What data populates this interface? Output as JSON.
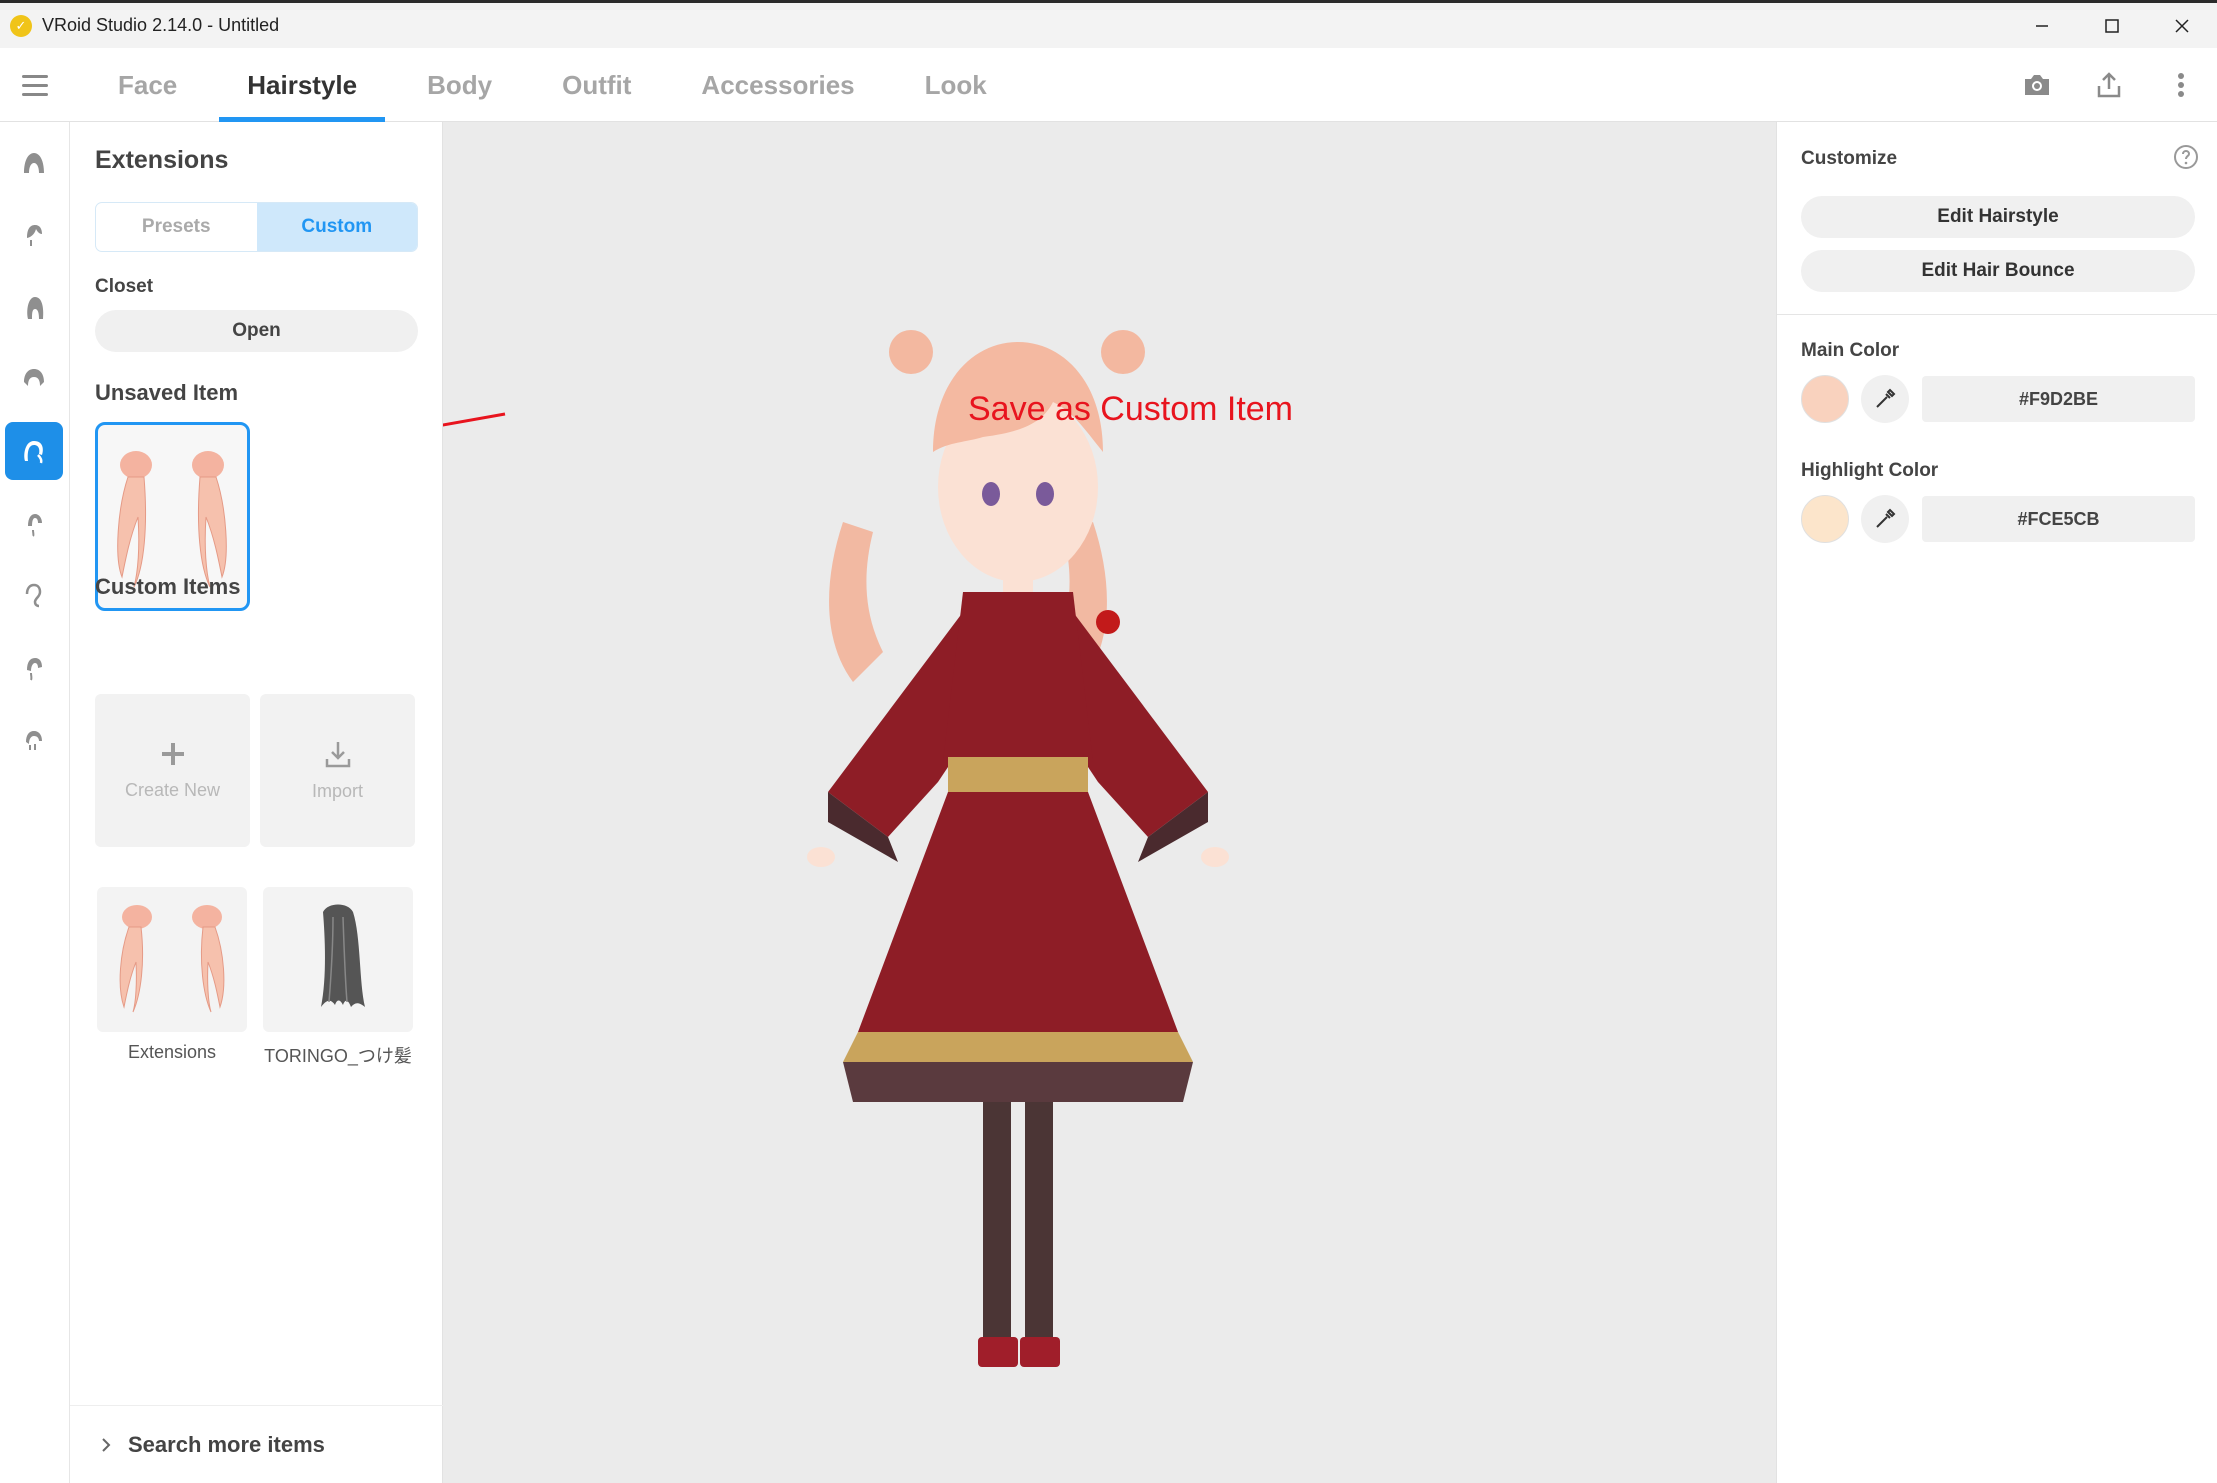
{
  "window": {
    "title": "VRoid Studio 2.14.0 - Untitled"
  },
  "tabs": [
    "Face",
    "Hairstyle",
    "Body",
    "Outfit",
    "Accessories",
    "Look"
  ],
  "active_tab": "Hairstyle",
  "left_panel": {
    "heading": "Extensions",
    "segments": {
      "presets": "Presets",
      "custom": "Custom"
    },
    "closet": {
      "label": "Closet",
      "button": "Open"
    },
    "unsaved_label": "Unsaved Item",
    "custom_items_label": "Custom Items",
    "create_new": "Create New",
    "import": "Import",
    "items": [
      {
        "label": "Extensions"
      },
      {
        "label": "TORINGO_つけ髪"
      }
    ],
    "search_more": "Search more items"
  },
  "annotation": "Save as Custom Item",
  "right_panel": {
    "customize_label": "Customize",
    "edit_hairstyle": "Edit Hairstyle",
    "edit_hair_bounce": "Edit Hair Bounce",
    "main_color": {
      "label": "Main Color",
      "hex": "#F9D2BE"
    },
    "highlight_color": {
      "label": "Highlight Color",
      "hex": "#FCE5CB"
    }
  },
  "colors": {
    "accent": "#2196f3",
    "annotation": "#e8141e",
    "hair": "#f4b8a0",
    "dress": "#8e1d26",
    "gold": "#c9a45c"
  },
  "icons": [
    "menu-icon",
    "camera-icon",
    "export-icon",
    "more-vertical-icon",
    "help-icon",
    "eyedropper-icon",
    "plus-icon",
    "download-icon",
    "chevron-right-icon"
  ]
}
